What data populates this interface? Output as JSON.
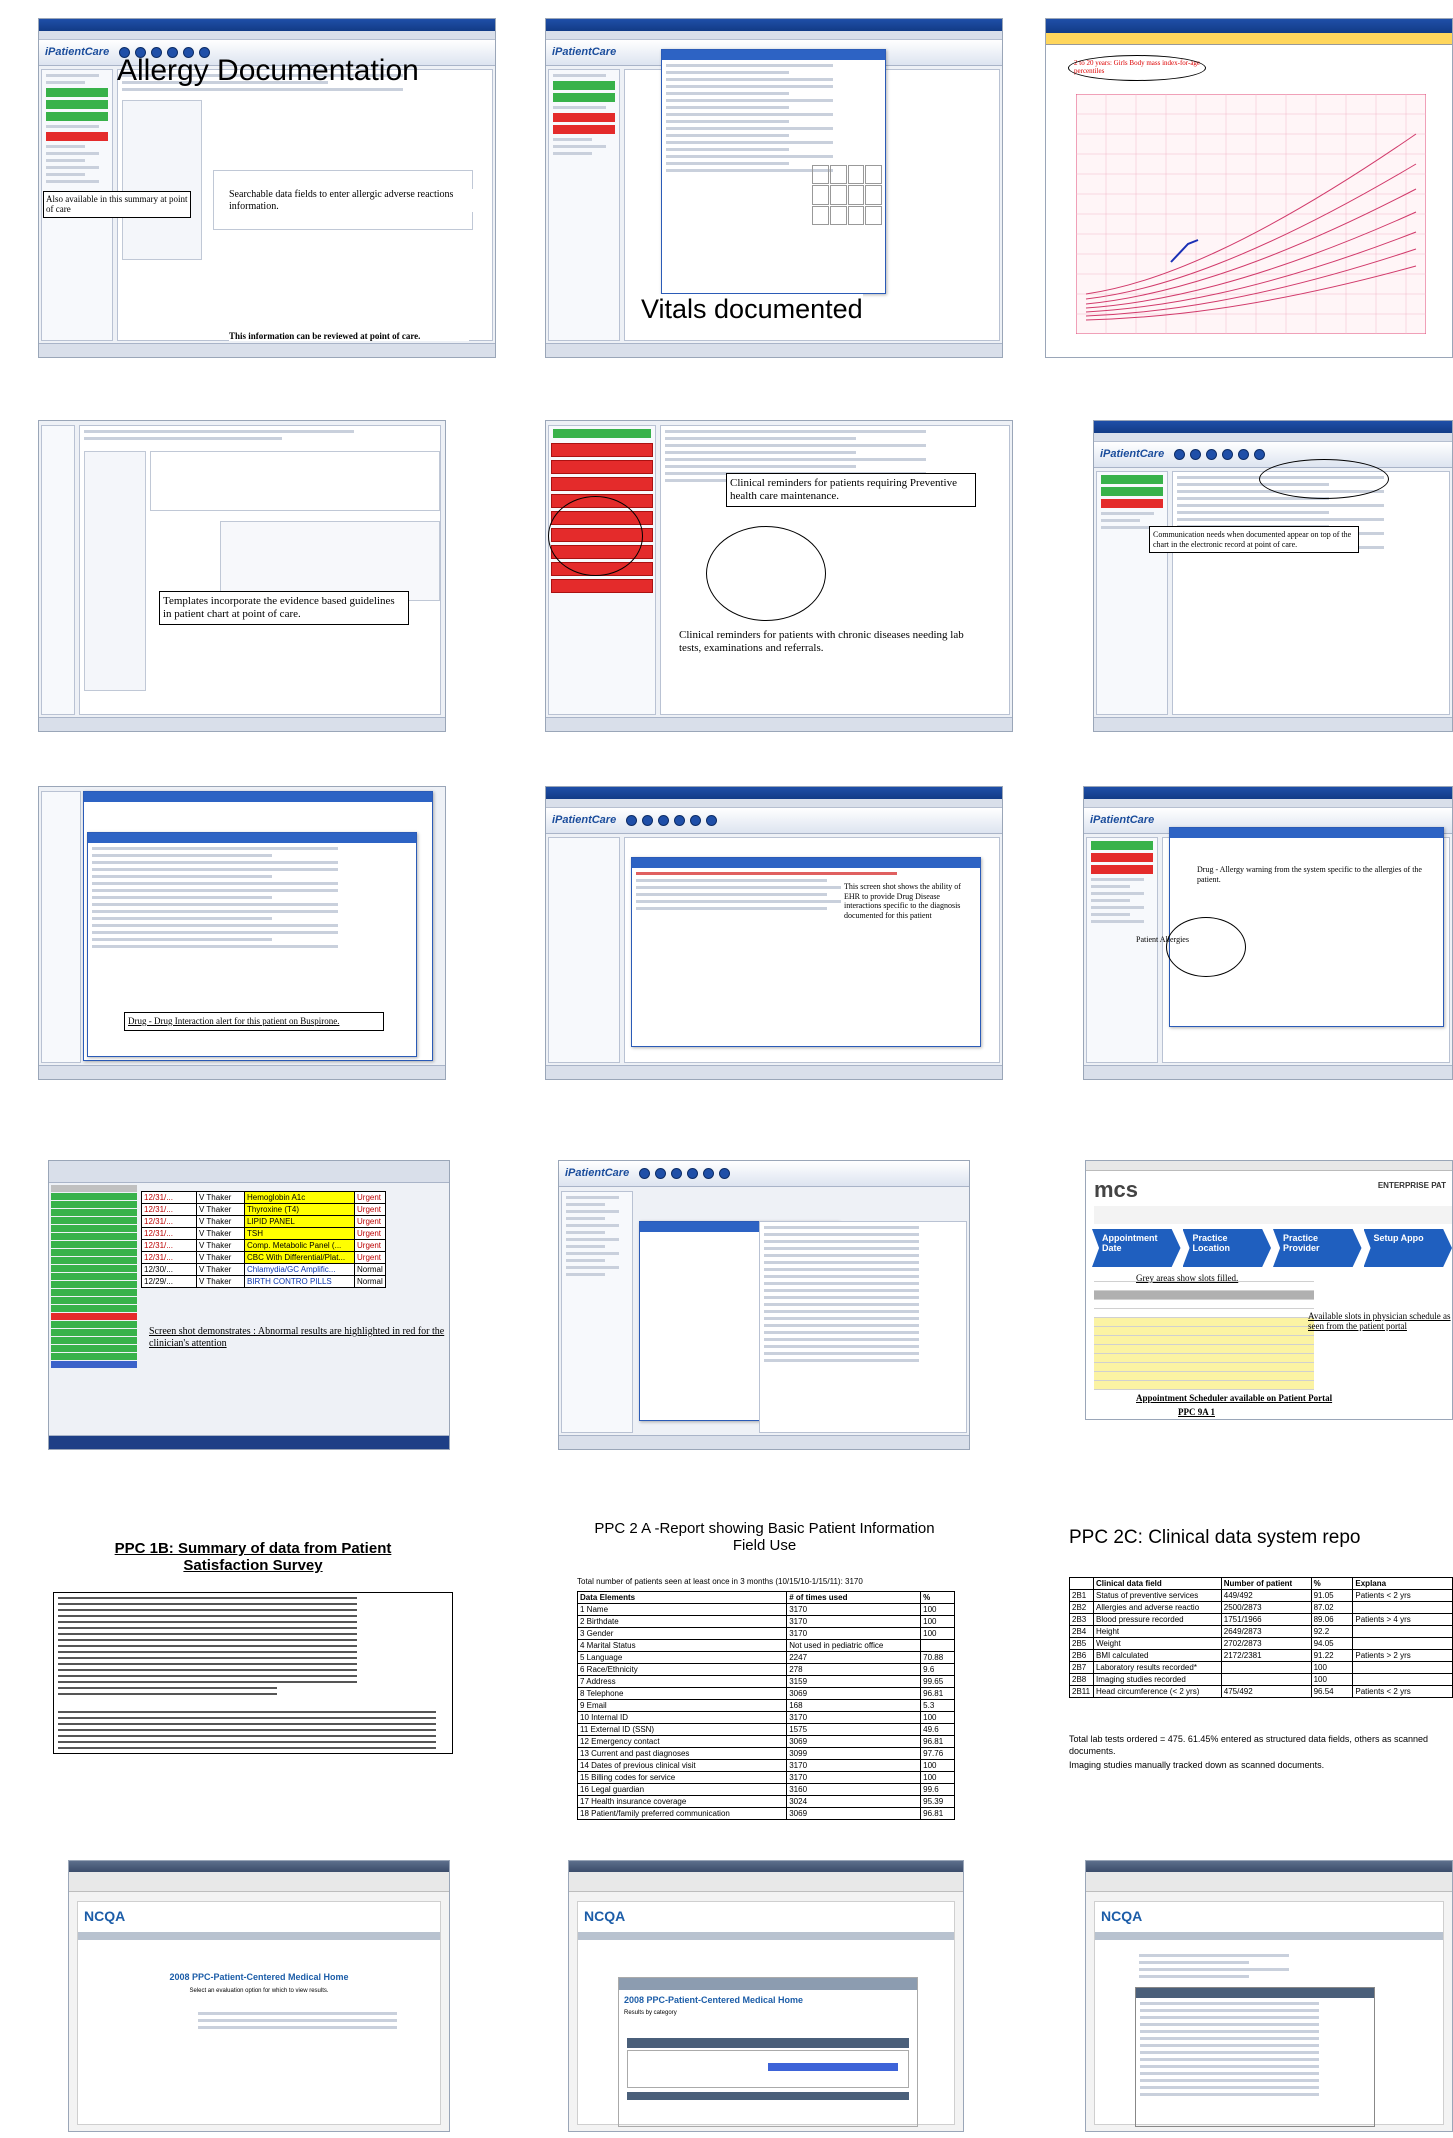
{
  "row1": {
    "allergy_title": "Allergy Documentation",
    "allergy_search_note": "Searchable data fields to enter allergic adverse reactions information.",
    "allergy_summary_note": "Also available in this summary at point of care",
    "allergy_review_note": "This information can be reviewed at point of care.",
    "vitals_title": "Vitals documented",
    "growth_chart_note": "2 to 20 years: Girls Body mass index-for-age percentiles"
  },
  "row2": {
    "templates_note": "Templates incorporate the evidence based guidelines in patient chart at point of care.",
    "preventive_note": "Clinical reminders for patients requiring Preventive health care maintenance.",
    "chronic_note": "Clinical reminders for patients with chronic diseases needing lab tests, examinations and referrals.",
    "communication_note": "Communication needs when documented appear on top of the chart in the electronic record at point of care."
  },
  "row3": {
    "drug_drug_note": "Drug - Drug Interaction alert for this patient on Buspirone.",
    "disease_note": "This screen shot shows the ability of EHR to provide Drug Disease interactions specific to the diagnosis documented for this patient",
    "drug_allergy_note": "Drug - Allergy warning from the system specific to the allergies of the patient.",
    "patient_allergies_label": "Patient Allergies"
  },
  "row4": {
    "abnormal_note": "Screen shot demonstrates : Abnormal results are highlighted in red for the clinician's attention",
    "mcs_logo": "mcs",
    "mcs_enterprise": "ENTERPRISE PAT",
    "mcs_steps": [
      "Appointment Date",
      "Practice Location",
      "Practice Provider",
      "Setup Appo"
    ],
    "grey_note": "Grey areas show slots filled.",
    "available_note": "Available slots in physician schedule as seen from the patient portal",
    "scheduler_note": "Appointment Scheduler available on Patient Portal",
    "ppc_label": "PPC 9A 1",
    "lab_rows": [
      {
        "date": "12/31/...",
        "provider": "V Thaker",
        "subject": "Hemoglobin A1c",
        "priority": "Urgent"
      },
      {
        "date": "12/31/...",
        "provider": "V Thaker",
        "subject": "Thyroxine (T4)",
        "priority": "Urgent"
      },
      {
        "date": "12/31/...",
        "provider": "V Thaker",
        "subject": "LIPID PANEL",
        "priority": "Urgent"
      },
      {
        "date": "12/31/...",
        "provider": "V Thaker",
        "subject": "TSH",
        "priority": "Urgent"
      },
      {
        "date": "12/31/...",
        "provider": "V Thaker",
        "subject": "Comp. Metabolic Panel (...",
        "priority": "Urgent"
      },
      {
        "date": "12/31/...",
        "provider": "V Thaker",
        "subject": "CBC With Differential/Plat...",
        "priority": "Urgent"
      },
      {
        "date": "12/30/...",
        "provider": "V Thaker",
        "subject": "Chlamydia/GC Amplific...",
        "priority": "Normal"
      },
      {
        "date": "12/29/...",
        "provider": "V Thaker",
        "subject": "BIRTH CONTRO PILLS",
        "priority": "Normal"
      }
    ]
  },
  "ppc1b": {
    "title": "PPC 1B: Summary of data from Patient Satisfaction Survey"
  },
  "ppc2a": {
    "title": "PPC 2 A -Report showing Basic Patient Information Field Use",
    "header_note": "Total number of patients seen at least once in 3 months (10/15/10-1/15/11): 3170",
    "columns": [
      "Data Elements",
      "# of times used",
      "%"
    ],
    "rows": [
      [
        "1 Name",
        "3170",
        "100"
      ],
      [
        "2 Birthdate",
        "3170",
        "100"
      ],
      [
        "3 Gender",
        "3170",
        "100"
      ],
      [
        "4 Marital Status",
        "Not used in pediatric office",
        ""
      ],
      [
        "5 Language",
        "2247",
        "70.88"
      ],
      [
        "6 Race/Ethnicity",
        "278",
        "9.6"
      ],
      [
        "7 Address",
        "3159",
        "99.65"
      ],
      [
        "8 Telephone",
        "3069",
        "96.81"
      ],
      [
        "9 Email",
        "168",
        "5.3"
      ],
      [
        "10 Internal ID",
        "3170",
        "100"
      ],
      [
        "11 External ID (SSN)",
        "1575",
        "49.6"
      ],
      [
        "12 Emergency contact",
        "3069",
        "96.81"
      ],
      [
        "13 Current and past diagnoses",
        "3099",
        "97.76"
      ],
      [
        "14 Dates of previous clinical visit",
        "3170",
        "100"
      ],
      [
        "15 Billing codes for service",
        "3170",
        "100"
      ],
      [
        "16 Legal guardian",
        "3160",
        "99.6"
      ],
      [
        "17 Health insurance coverage",
        "3024",
        "95.39"
      ],
      [
        "18 Patient/family preferred communication",
        "3069",
        "96.81"
      ]
    ]
  },
  "ppc2c": {
    "title": "PPC 2C: Clinical data system repo",
    "columns": [
      "Clinical data field",
      "Number of patient",
      "%",
      "Explana"
    ],
    "rows": [
      [
        "2B1",
        "Status of preventive services",
        "449/492",
        "91.05",
        "Patients < 2 yrs"
      ],
      [
        "2B2",
        "Allergies and adverse reactio",
        "2500/2873",
        "87.02",
        ""
      ],
      [
        "2B3",
        "Blood pressure recorded",
        "1751/1966",
        "89.06",
        "Patients > 4 yrs"
      ],
      [
        "2B4",
        "Height",
        "2649/2873",
        "92.2",
        ""
      ],
      [
        "2B5",
        "Weight",
        "2702/2873",
        "94.05",
        ""
      ],
      [
        "2B6",
        "BMI calculated",
        "2172/2381",
        "91.22",
        "Patients > 2 yrs"
      ],
      [
        "2B7",
        "Laboratory results recorded*",
        "",
        "100",
        ""
      ],
      [
        "2B8",
        "Imaging studies recorded",
        "",
        "100",
        ""
      ],
      [
        "2B11",
        "Head circumference (< 2 yrs)",
        "475/492",
        "96.54",
        "Patients < 2 yrs"
      ]
    ],
    "footnote1": "Total lab tests ordered = 475. 61.45% entered as structured data fields, others as scanned documents.",
    "footnote2": "Imaging studies manually tracked down as scanned documents."
  },
  "row6": {
    "ncqa_logo": "NCQA",
    "survey_heading": "2008 PPC-Patient-Centered Medical Home",
    "survey_sub": "Select an evaluation option for which to view results.",
    "results_heading": "2008 PPC-Patient-Centered Medical Home",
    "results_sub": "Results by category"
  }
}
